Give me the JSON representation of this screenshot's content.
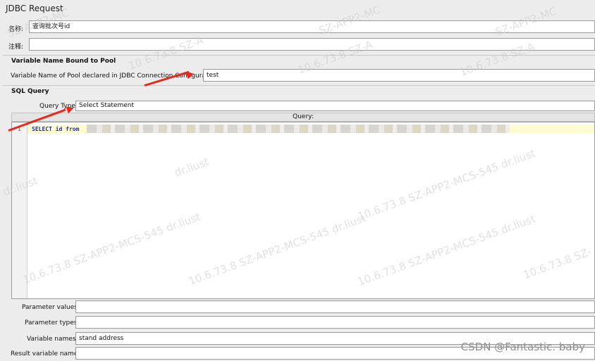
{
  "window": {
    "title": "JDBC Request"
  },
  "name_field": {
    "label": "名称:",
    "value": "查询批次号id"
  },
  "comment_field": {
    "label": "注释:",
    "value": ""
  },
  "pool_section": {
    "title": "Variable Name Bound to Pool",
    "pool_label": "Variable Name of Pool declared in JDBC Connection Configuration:",
    "pool_value": "test"
  },
  "sql_section": {
    "title": "SQL Query",
    "query_type_label": "Query Type:",
    "query_type_value": "Select Statement",
    "query_header": "Query:",
    "line_number": "1",
    "query_text": "SELECT id from"
  },
  "params": {
    "parameter_values_label": "Parameter values:",
    "parameter_values": "",
    "parameter_types_label": "Parameter types:",
    "parameter_types": "",
    "variable_names_label": "Variable names:",
    "variable_names": "stand address",
    "result_variable_label": "Result variable name:",
    "result_variable": ""
  },
  "watermarks": {
    "primary": "10.6.73.8 SZ-APP2-MCS-545 dr.liust",
    "fragment_1": "SZ-APP2-MC",
    "fragment_2": "SZ-APP2-MC",
    "fragment_3": "SZ-APP2-MC",
    "fragment_4": "10.6.73.8 SZ-A",
    "fragment_5": "10.6.73.8 SZ-A",
    "fragment_6": "10.6.73.8 SZ-A",
    "fragment_7": "dr.liust",
    "fragment_8": "dr.liust",
    "fragment_9": "10.6.73.8 SZ-APP2-MCS-545 dr.liust",
    "fragment_10": "10.6.73.8 SZ-APP2-MCS-545 dr.liust",
    "fragment_11": "10.6.73.8 SZ-APP2-MCS-545 dr.liust",
    "fragment_12": "10.6.73.8 SZ-APP2-MCS-545 dr.liust",
    "fragment_13": "10.6.73.8 SZ-"
  },
  "credit": "CSDN @Fantastic. baby",
  "colors": {
    "annotation_arrow": "#e8281d",
    "editor_line_highlight": "#fefcd0",
    "sql_keyword": "#1d2fa5"
  }
}
